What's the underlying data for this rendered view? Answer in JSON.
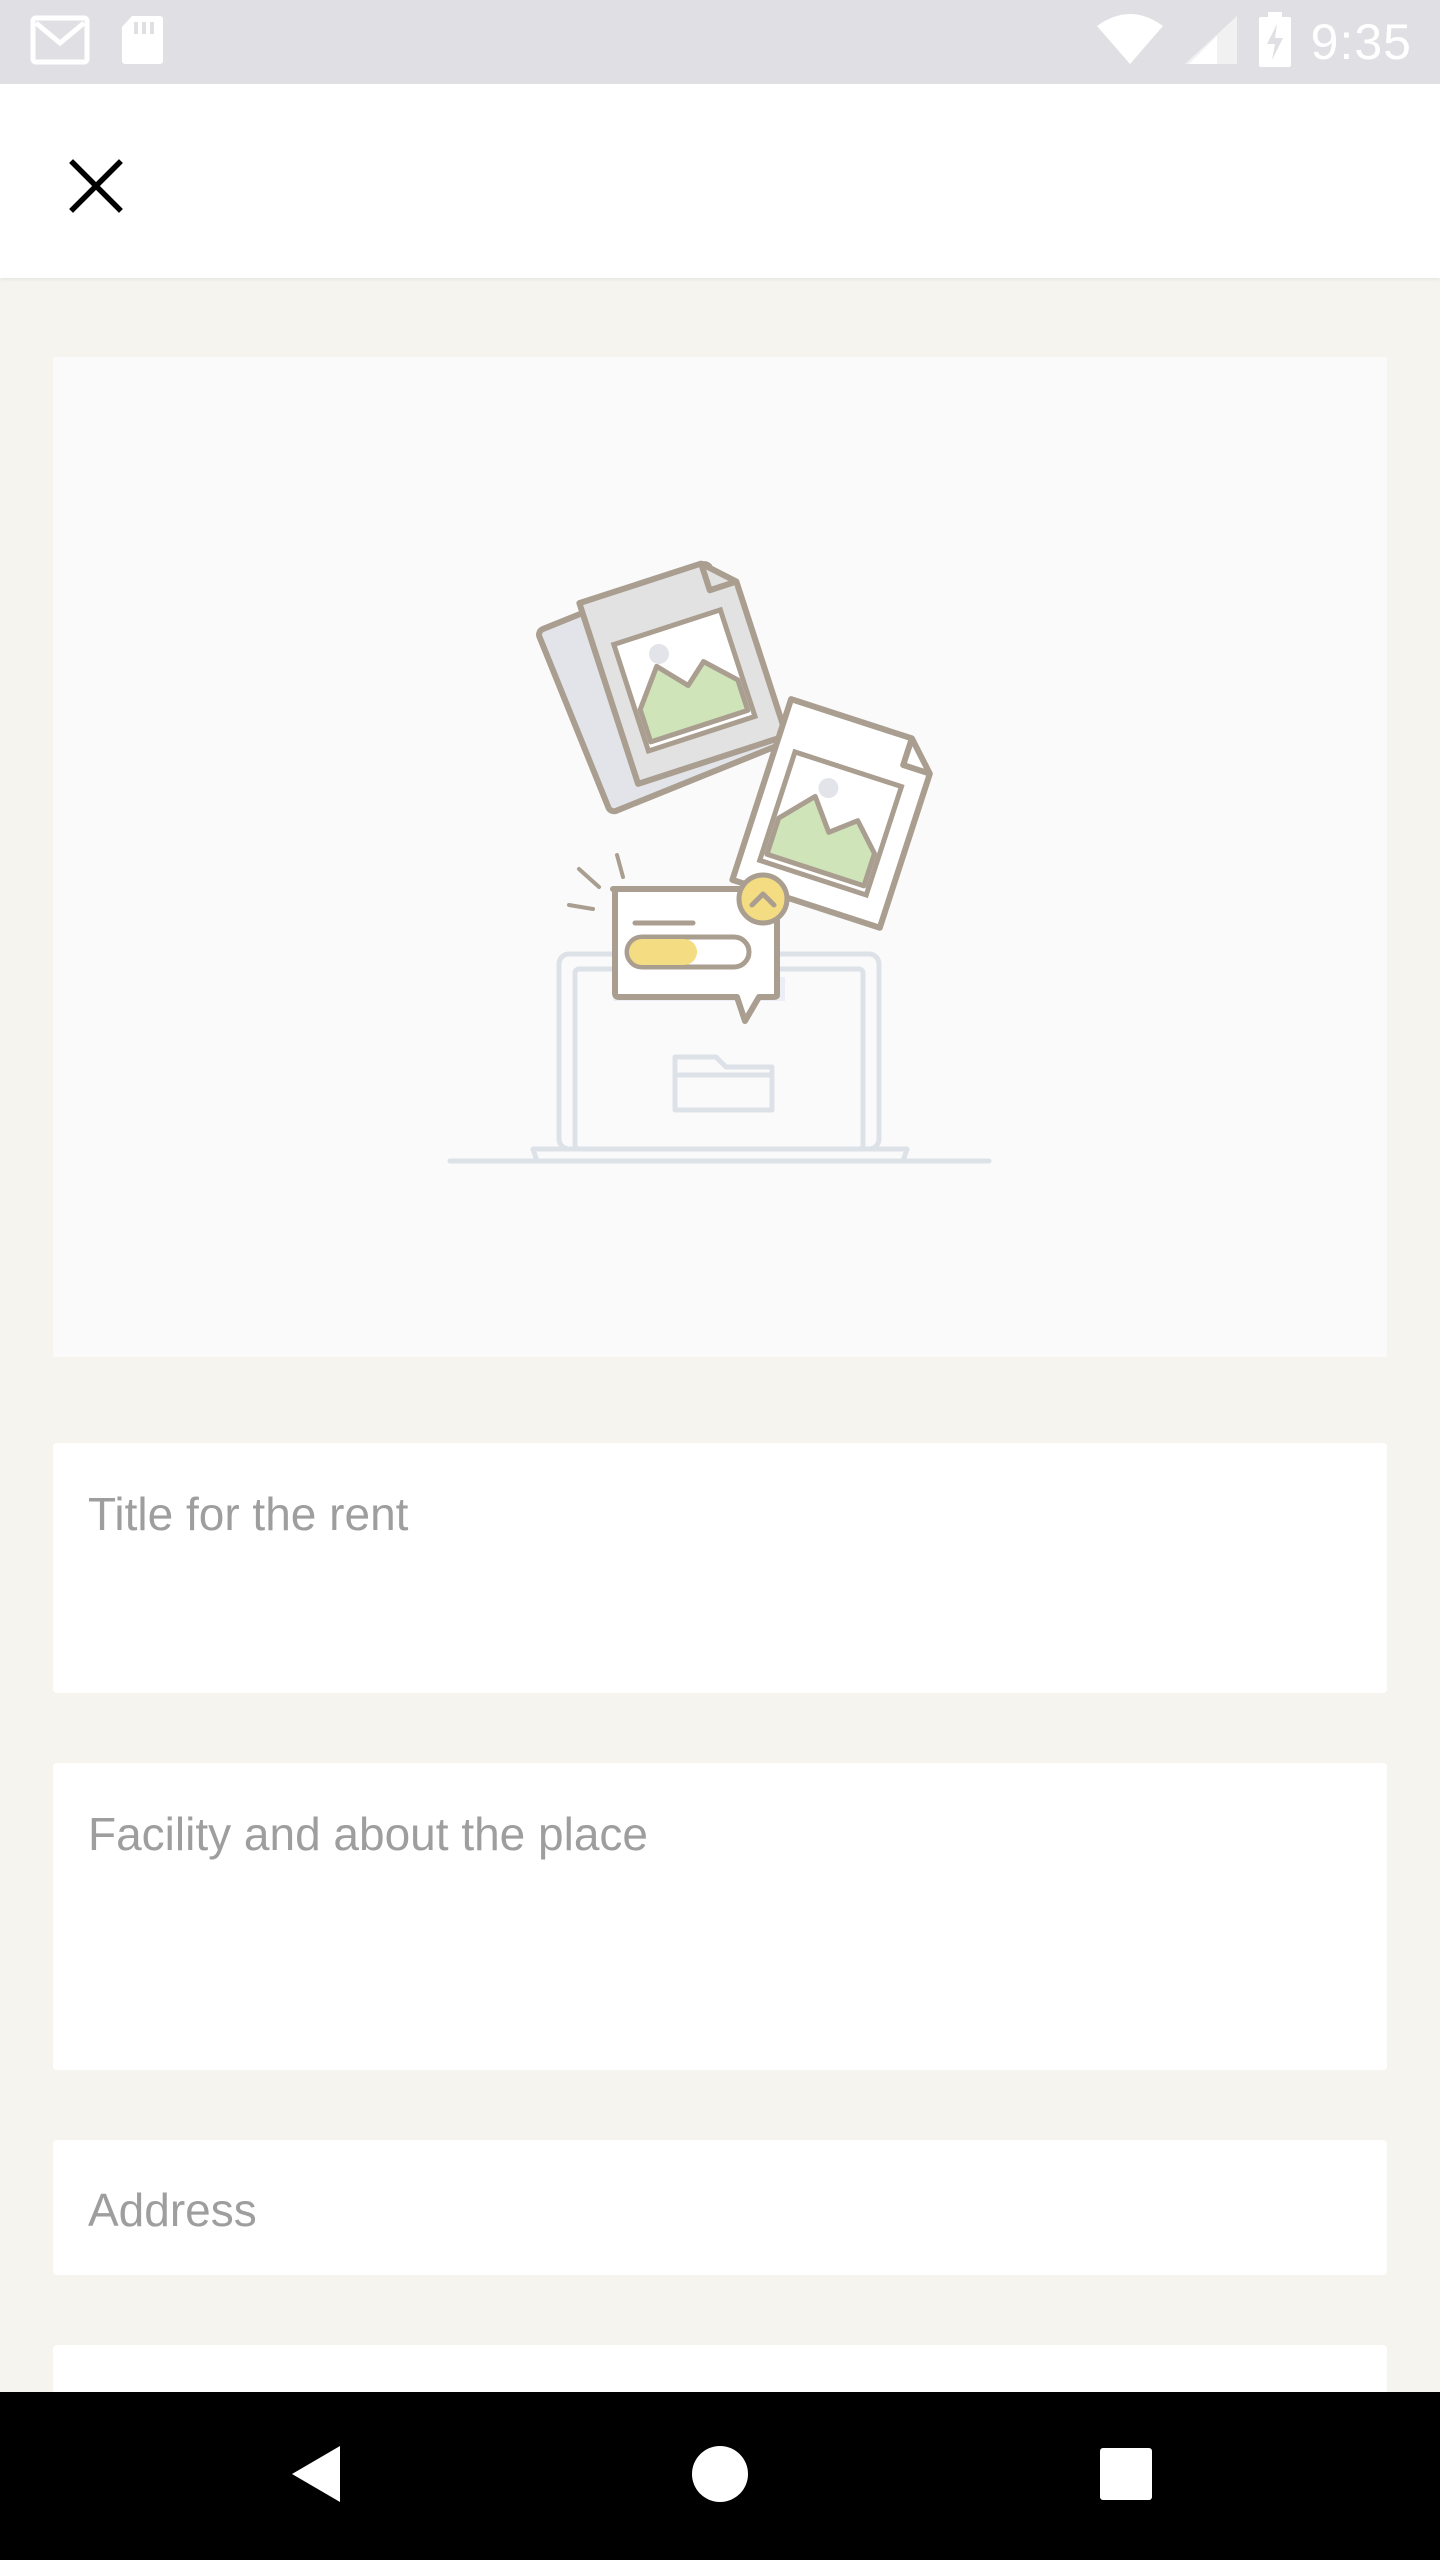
{
  "status_bar": {
    "time": "9:35",
    "left_icons": [
      "gmail-icon",
      "sd-card-icon"
    ],
    "right_icons": [
      "wifi-icon",
      "signal-icon",
      "battery-charging-icon"
    ]
  },
  "app_bar": {
    "close_icon": "close-icon"
  },
  "hero": {
    "illustration": "image-upload-illustration",
    "colors": {
      "outline": "#A99E8F",
      "photo_green": "#CFE4B8",
      "progress_yellow": "#F4DC82",
      "laptop_line": "#DDE1E8"
    }
  },
  "form": {
    "title_placeholder": "Title for the rent",
    "description_placeholder": "Facility and about the place",
    "address_placeholder": "Address"
  },
  "nav_bar": {
    "icons": [
      "back-icon",
      "home-icon",
      "recents-icon"
    ]
  }
}
